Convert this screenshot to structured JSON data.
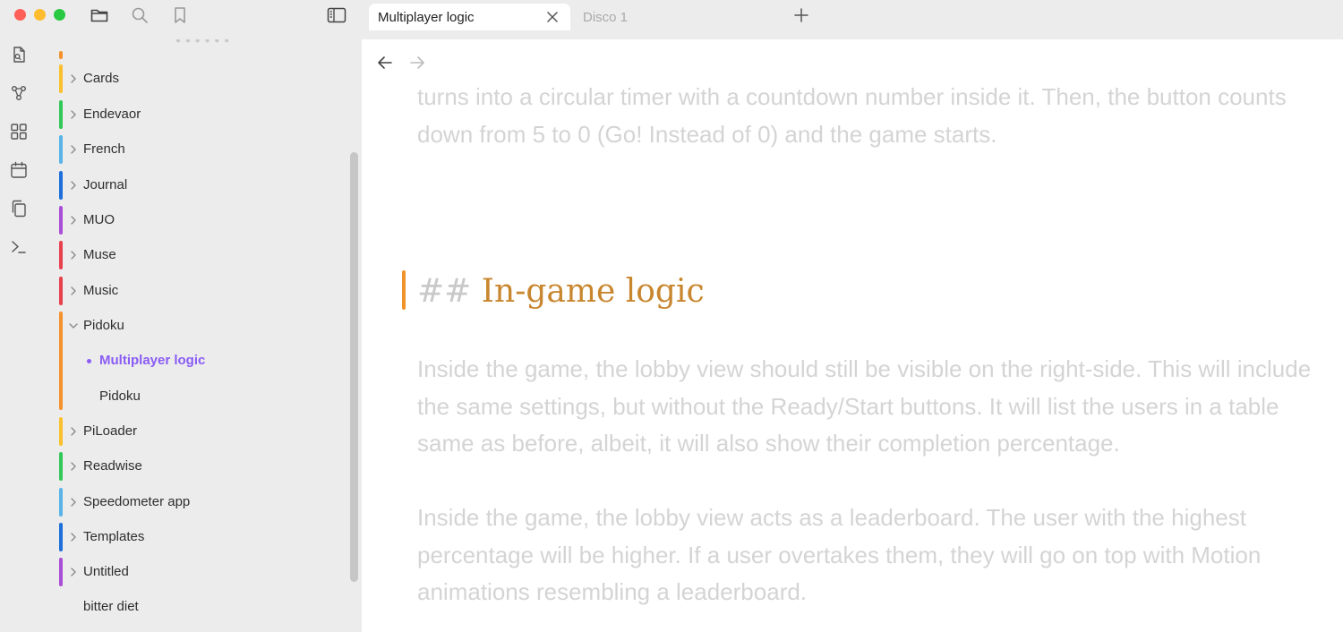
{
  "tabs": {
    "active_label": "Multiplayer logic",
    "inactive_label": "Disco 1"
  },
  "colors": {
    "accent": "#8a5cf5",
    "heading": "#c8862e",
    "heading_marker": "#f0932b"
  },
  "sidebar": {
    "folders": [
      {
        "label": "Cards",
        "color": "#fbc02d",
        "expanded": false
      },
      {
        "label": "Endevaor",
        "color": "#34c759",
        "expanded": false
      },
      {
        "label": "French",
        "color": "#5ab4e8",
        "expanded": false
      },
      {
        "label": "Journal",
        "color": "#1e6fd9",
        "expanded": false
      },
      {
        "label": "MUO",
        "color": "#a94fd6",
        "expanded": false
      },
      {
        "label": "Muse",
        "color": "#e8414e",
        "expanded": false
      },
      {
        "label": "Music",
        "color": "#e8414e",
        "expanded": false
      },
      {
        "label": "Pidoku",
        "color": "#f5922e",
        "expanded": true
      },
      {
        "label": "PiLoader",
        "color": "#fbc02d",
        "expanded": false
      },
      {
        "label": "Readwise",
        "color": "#34c759",
        "expanded": false
      },
      {
        "label": "Speedometer app",
        "color": "#5ab4e8",
        "expanded": false
      },
      {
        "label": "Templates",
        "color": "#1e6fd9",
        "expanded": false
      },
      {
        "label": "Untitled",
        "color": "#a94fd6",
        "expanded": false
      }
    ],
    "children": [
      {
        "label": "Multiplayer logic",
        "active": true
      },
      {
        "label": "Pidoku",
        "active": false
      }
    ],
    "loose_file": "bitter diet"
  },
  "editor": {
    "paragraph_top": "turns into a circular timer with a countdown number inside it. Then, the button counts down from 5 to 0 (Go! Instead of 0) and the game starts.",
    "heading_marker": "##",
    "heading_text": "In-game logic",
    "paragraph_1": "Inside the game, the lobby view should still be visible on the right-side. This will include the same settings, but without the Ready/Start buttons. It will list the users in a table same as before, albeit, it will also show their completion percentage.",
    "paragraph_2": "Inside the game, the lobby view acts as a leaderboard. The user with the highest percentage will be higher. If a user overtakes them, they will go on top with Motion animations resembling a leaderboard."
  },
  "icons": {
    "titlebar": [
      "folder-icon",
      "search-icon",
      "bookmark-icon",
      "sidebar-toggle-icon"
    ],
    "ribbon": [
      "file-switcher-icon",
      "graph-view-icon",
      "canvas-icon",
      "calendar-icon",
      "copy-icon",
      "terminal-icon"
    ]
  }
}
